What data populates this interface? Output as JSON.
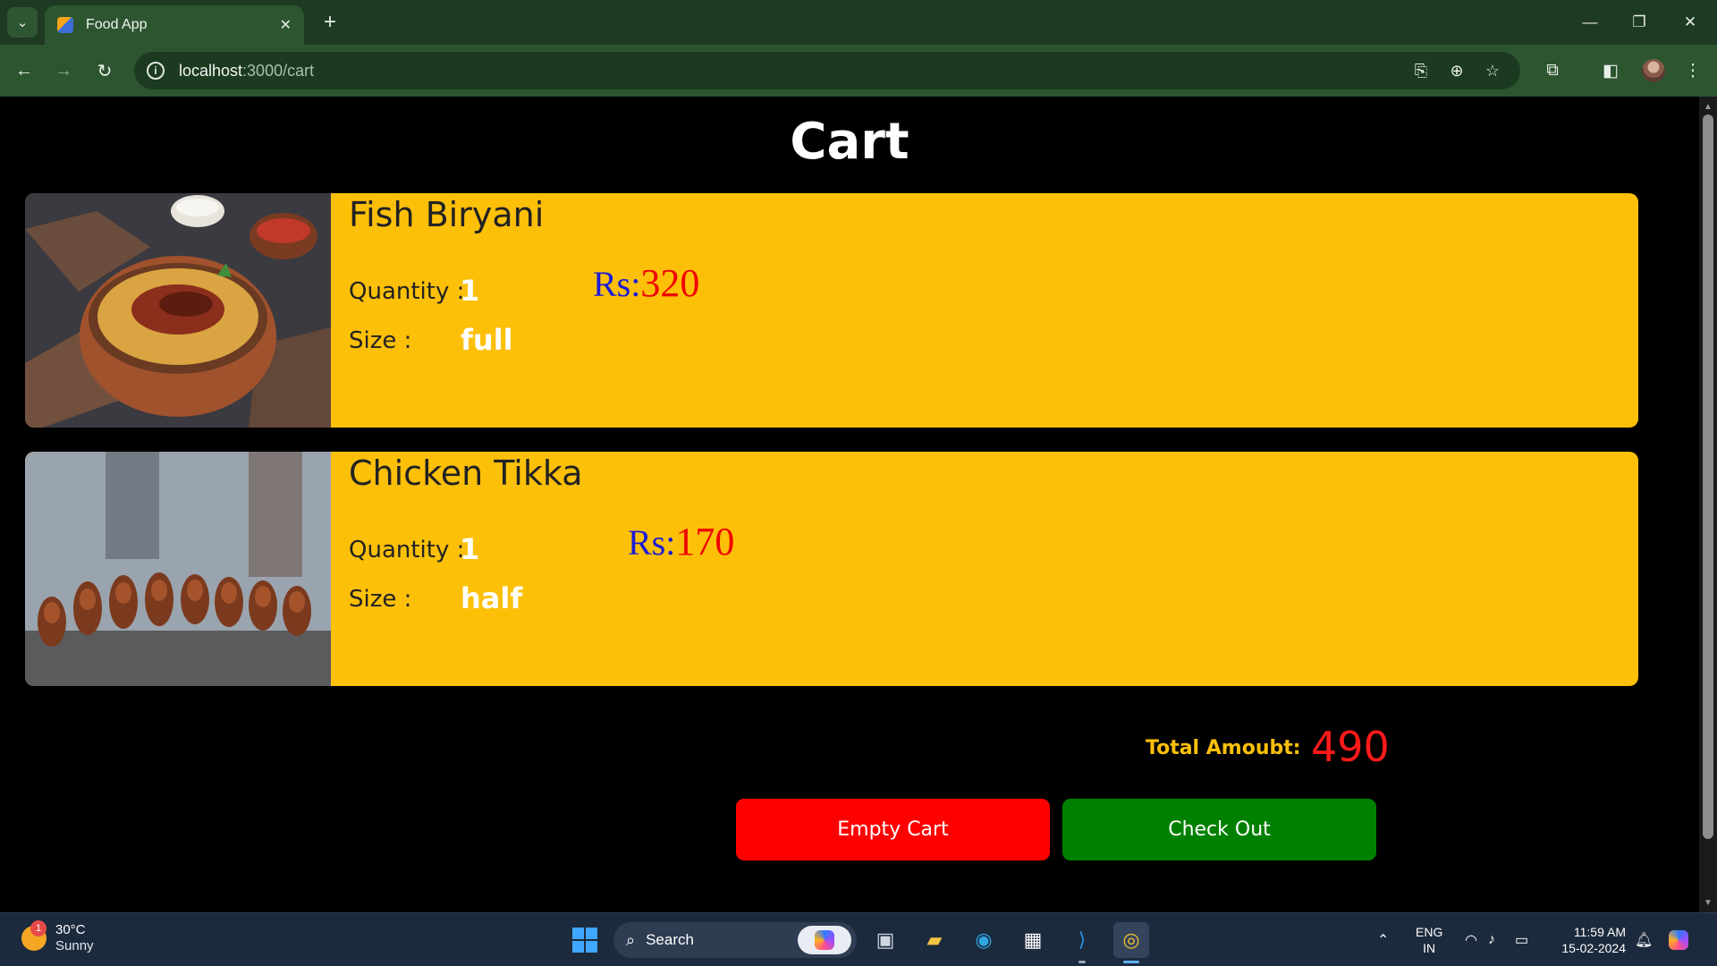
{
  "browser": {
    "tab_title": "Food App",
    "tab_close": "✕",
    "new_tab": "+",
    "url_host": "localhost",
    "url_path": ":3000/cart",
    "window_controls": {
      "minimize": "—",
      "restore": "❐",
      "close": "✕"
    },
    "icons": [
      "tab-search-icon",
      "back-icon",
      "forward-icon",
      "reload-icon",
      "site-info-icon",
      "install-icon",
      "zoom-icon",
      "bookmark-star-icon",
      "extensions-icon",
      "side-panel-icon",
      "profile-avatar",
      "menu-icon"
    ]
  },
  "page": {
    "title": "Cart",
    "items": [
      {
        "name": "Fish Biryani",
        "quantity_label": "Quantity :",
        "quantity": "1",
        "size_label": "Size :",
        "size": "full",
        "currency": "Rs:",
        "price": "320",
        "image": "biryani-photo"
      },
      {
        "name": "Chicken Tikka",
        "quantity_label": "Quantity :",
        "quantity": "1",
        "size_label": "Size :",
        "size": "half",
        "currency": "Rs:",
        "price": "170",
        "image": "tikka-photo"
      }
    ],
    "total_label": "Total Amoubt:",
    "total_value": "490",
    "empty_cart_label": "Empty Cart",
    "checkout_label": "Check Out",
    "colors": {
      "card": "#fdc009",
      "empty_btn": "#ff0000",
      "checkout_btn": "#008000",
      "price_currency": "#1b1bd6",
      "price_amount": "#f00000"
    }
  },
  "taskbar": {
    "weather_badge": "1",
    "temperature": "30°C",
    "condition": "Sunny",
    "search_placeholder": "Search",
    "lang_top": "ENG",
    "lang_bottom": "IN",
    "time": "11:59 AM",
    "date": "15-02-2024",
    "apps": [
      "start-icon",
      "search",
      "copilot-icon",
      "task-view-icon",
      "file-explorer-icon",
      "edge-icon",
      "store-icon",
      "vscode-icon",
      "chrome-icon"
    ]
  }
}
